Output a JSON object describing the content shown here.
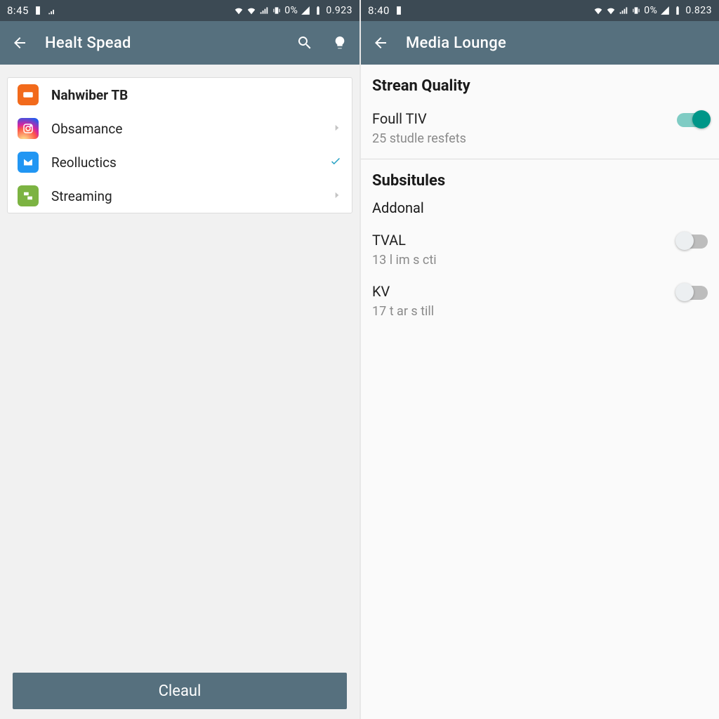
{
  "left": {
    "status": {
      "time": "8:45",
      "battery_pct": "0%",
      "extra": "0.923"
    },
    "appbar": {
      "title": "Healt Spead"
    },
    "list": {
      "items": [
        {
          "label": "Nahwiber TB",
          "bold": true,
          "icon": "orange",
          "trail": "none"
        },
        {
          "label": "Obsamance",
          "bold": false,
          "icon": "insta",
          "trail": "chev"
        },
        {
          "label": "Reolluctics",
          "bold": false,
          "icon": "blue",
          "trail": "check"
        },
        {
          "label": "Streaming",
          "bold": false,
          "icon": "green",
          "trail": "chev"
        }
      ]
    },
    "bottom_button": "Cleaul"
  },
  "right": {
    "status": {
      "time": "8:40",
      "battery_pct": "0%",
      "extra": "0.823"
    },
    "appbar": {
      "title": "Media Lounge"
    },
    "sections": {
      "stream_quality": {
        "title": "Strean Quality",
        "row": {
          "primary": "Foull TIV",
          "secondary": "25 studle resfets",
          "on": true
        }
      },
      "subtitles": {
        "title": "Subsitules",
        "addonal_label": "Addonal",
        "rows": [
          {
            "primary": "TVAL",
            "secondary": "13 l im s cti",
            "on": false
          },
          {
            "primary": "KV",
            "secondary": "17 t ar s till",
            "on": false
          }
        ]
      }
    }
  }
}
